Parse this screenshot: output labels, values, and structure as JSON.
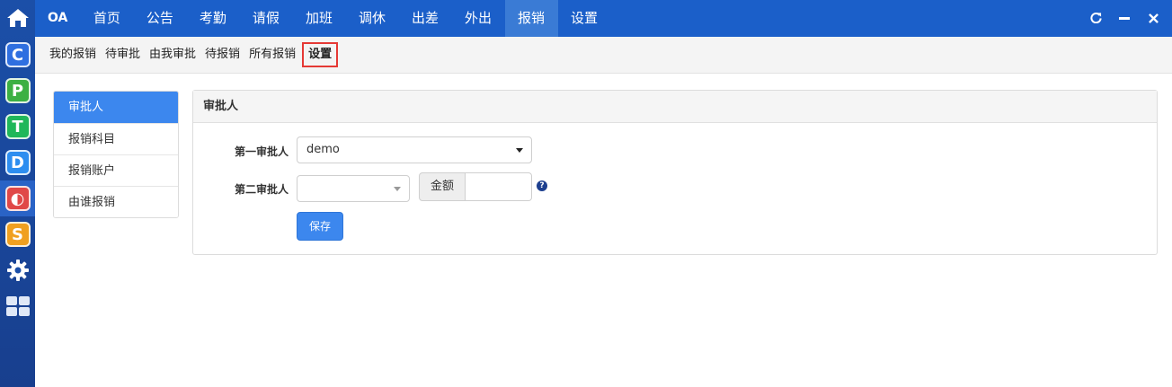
{
  "topnav": {
    "brand": "OA",
    "items": [
      "首页",
      "公告",
      "考勤",
      "请假",
      "加班",
      "调休",
      "出差",
      "外出",
      "报销",
      "设置"
    ],
    "active_index": 8,
    "controls": {
      "refresh_icon": "refresh-icon",
      "minimize_icon": "minimize-icon",
      "close_icon": "close-icon"
    }
  },
  "dock": {
    "items": [
      {
        "icon": "home-icon",
        "glyph": "⌂",
        "color": ""
      },
      {
        "icon": "app-c-icon",
        "glyph": "C",
        "color": "#2f6fe0"
      },
      {
        "icon": "app-p-icon",
        "glyph": "P",
        "color": "#3cb043"
      },
      {
        "icon": "app-t-icon",
        "glyph": "T",
        "color": "#1fb75a"
      },
      {
        "icon": "app-d-icon",
        "glyph": "D",
        "color": "#2d8ef0"
      },
      {
        "icon": "app-o-icon",
        "glyph": "◐",
        "color": "#e04848"
      },
      {
        "icon": "app-s-icon",
        "glyph": "S",
        "color": "#f0a020"
      },
      {
        "icon": "gear-icon",
        "glyph": "⚙",
        "color": ""
      },
      {
        "icon": "grid-icon",
        "glyph": "▦",
        "color": ""
      }
    ],
    "active_index": 5
  },
  "subnav": {
    "items": [
      "我的报销",
      "待审批",
      "由我审批",
      "待报销",
      "所有报销",
      "设置"
    ],
    "active_index": 5
  },
  "sidemenu": {
    "items": [
      "审批人",
      "报销科目",
      "报销账户",
      "由谁报销"
    ],
    "active_index": 0
  },
  "panel": {
    "title": "审批人",
    "first_approver_label": "第一审批人",
    "first_approver_value": "demo",
    "second_approver_label": "第二审批人",
    "second_approver_value": "",
    "amount_label": "金额",
    "amount_value": "",
    "help_glyph": "?",
    "save_label": "保存"
  },
  "colors": {
    "topnav": "#1b5fc9",
    "dock": "#1b4fa8",
    "primary_button": "#3c87ee",
    "highlight_border": "#e53935"
  }
}
